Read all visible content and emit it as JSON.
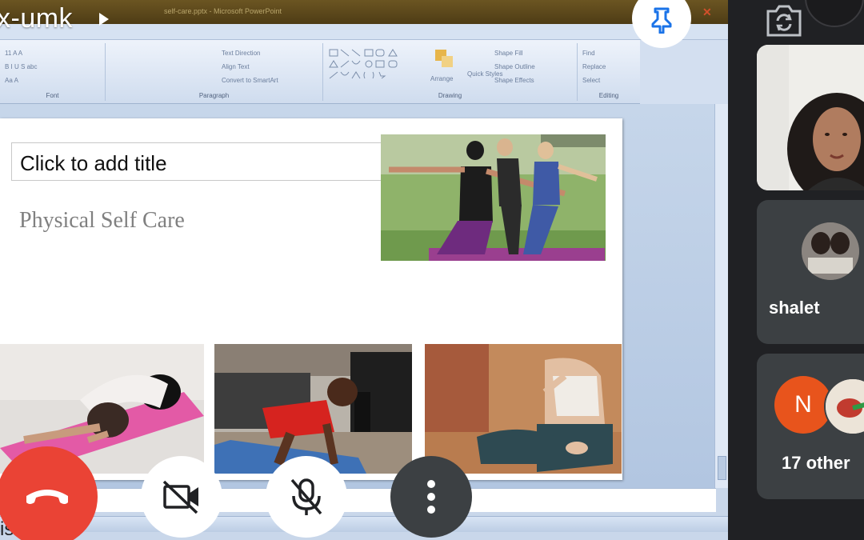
{
  "meeting": {
    "code_fragment": "x-umk",
    "presenting_fragment": "is    enting"
  },
  "powerpoint": {
    "window_title": "self-care.pptx - Microsoft PowerPoint",
    "ribbon_groups": [
      {
        "label": "Font",
        "items": [
          "11 A A",
          "B I U S abc",
          "Aa A"
        ]
      },
      {
        "label": "Paragraph",
        "items": [
          "Text Direction",
          "Align Text",
          "Convert to SmartArt"
        ]
      },
      {
        "label": "Drawing",
        "items": [
          "Arrange",
          "Quick Styles",
          "Shape Fill",
          "Shape Outline",
          "Shape Effects"
        ]
      },
      {
        "label": "Editing",
        "items": [
          "Find",
          "Replace",
          "Select"
        ]
      }
    ]
  },
  "slide": {
    "title_placeholder": "Click to add title",
    "subtitle": "Physical Self Care"
  },
  "controls": {
    "end_call_icon": "phone-hangup-icon",
    "camera_icon": "video-off-icon",
    "mic_icon": "mic-off-icon",
    "more_icon": "more-vert-icon",
    "pin_icon": "pin-icon",
    "switch_camera_icon": "switch-camera-icon"
  },
  "participants": {
    "tile_name": "shalet",
    "others_initial": "N",
    "others_label": "17 other"
  },
  "colors": {
    "end_call_red": "#ea4335",
    "panel_bg": "#202124",
    "tile_bg": "#3c4043",
    "avatar_orange": "#e8541c",
    "pin_blue": "#1a73e8"
  }
}
